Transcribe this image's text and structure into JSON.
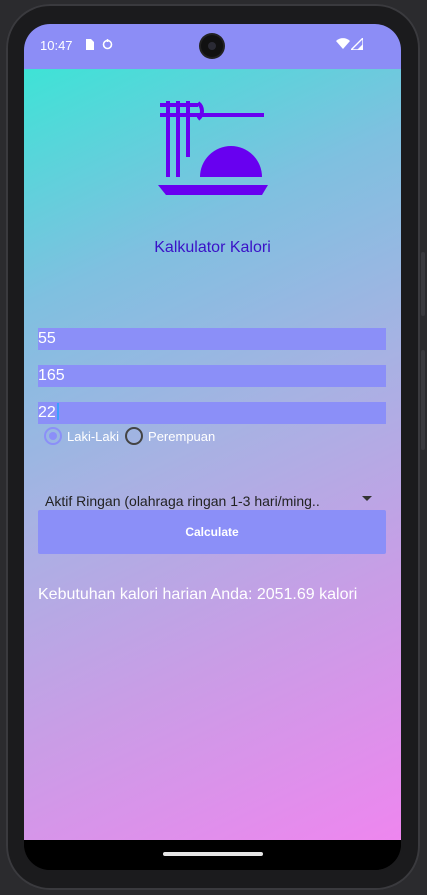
{
  "status_bar": {
    "time": "10:47",
    "icons": [
      "sim-card-icon",
      "sync-icon",
      "wifi-icon",
      "signal-icon"
    ]
  },
  "app": {
    "title": "Kalkulator Kalori",
    "logo_icon": "noodle-bowl-icon",
    "inputs": {
      "weight": "55",
      "height": "165",
      "age": "22"
    },
    "gender": {
      "options": [
        "Laki-Laki",
        "Perempuan"
      ],
      "selected": "Laki-Laki"
    },
    "activity": {
      "selected": "Aktif Ringan (olahraga ringan 1-3 hari/ming.."
    },
    "calculate_label": "Calculate",
    "result": "Kebutuhan kalori harian Anda: 2051.69 kalori"
  },
  "colors": {
    "accent": "#8b8ff8",
    "title": "#3a12c7",
    "icon": "#6800f0"
  }
}
